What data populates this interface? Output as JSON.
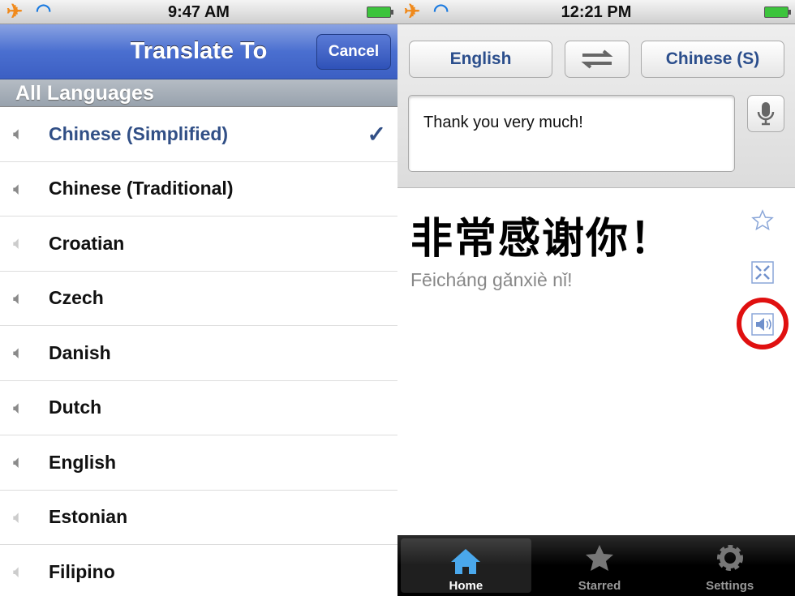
{
  "left": {
    "status": {
      "time": "9:47 AM"
    },
    "nav": {
      "title": "Translate To",
      "cancel": "Cancel"
    },
    "section": "All Languages",
    "languages": [
      {
        "name": "Chinese (Simplified)",
        "selected": true,
        "audio": true
      },
      {
        "name": "Chinese (Traditional)",
        "selected": false,
        "audio": true
      },
      {
        "name": "Croatian",
        "selected": false,
        "audio": false
      },
      {
        "name": "Czech",
        "selected": false,
        "audio": true
      },
      {
        "name": "Danish",
        "selected": false,
        "audio": true
      },
      {
        "name": "Dutch",
        "selected": false,
        "audio": true
      },
      {
        "name": "English",
        "selected": false,
        "audio": true
      },
      {
        "name": "Estonian",
        "selected": false,
        "audio": false
      },
      {
        "name": "Filipino",
        "selected": false,
        "audio": false
      }
    ],
    "checkmark": "✓"
  },
  "right": {
    "status": {
      "time": "12:21 PM"
    },
    "source_lang": "English",
    "target_lang": "Chinese (S)",
    "input_text": "Thank you very much!",
    "translation": "非常感谢你！",
    "romanization": "Fēicháng gǎnxiè nǐ!",
    "tabs": [
      {
        "label": "Home",
        "active": true
      },
      {
        "label": "Starred",
        "active": false
      },
      {
        "label": "Settings",
        "active": false
      }
    ],
    "highlight_color": "#e01010"
  }
}
